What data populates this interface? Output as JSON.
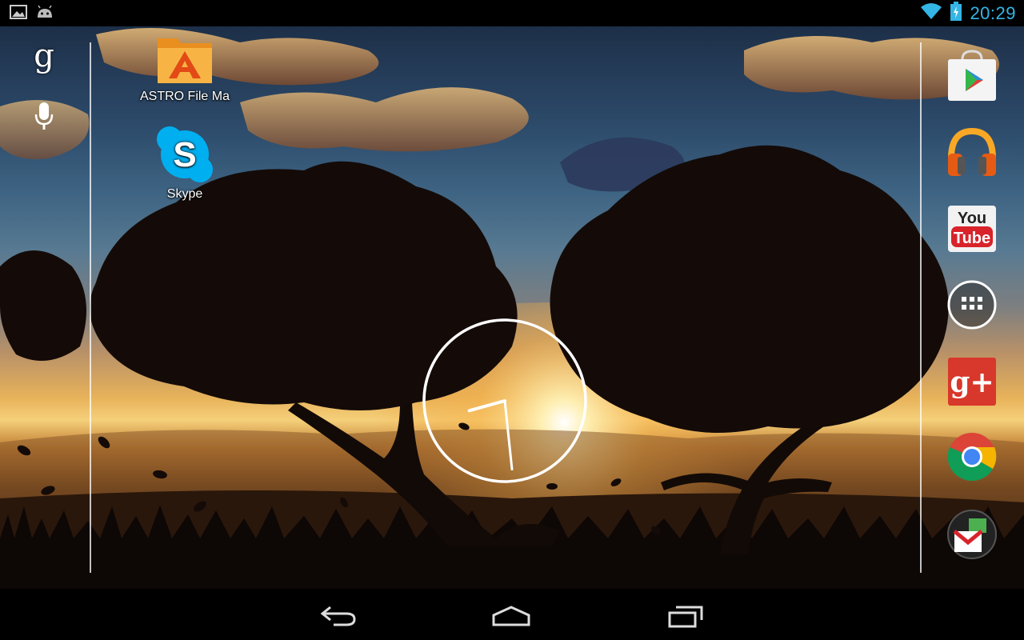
{
  "status_bar": {
    "left_icons": [
      "gallery-icon",
      "android-debug-icon"
    ],
    "right_icons": [
      "wifi-icon",
      "battery-icon"
    ],
    "time": "20:29",
    "accent_color": "#33b5e5"
  },
  "search_bar": {
    "icons": [
      "google-search-icon",
      "microphone-icon"
    ]
  },
  "shortcuts": [
    {
      "label": "ASTRO File Ma",
      "icon": "folder-astro-icon"
    },
    {
      "label": "Skype",
      "icon": "skype-icon"
    }
  ],
  "dock": [
    {
      "name": "Play Store",
      "icon": "play-store-icon"
    },
    {
      "name": "Play Music",
      "icon": "headphones-icon"
    },
    {
      "name": "YouTube",
      "icon": "youtube-icon",
      "text_top": "You",
      "text_bottom": "Tube"
    },
    {
      "name": "App Drawer",
      "icon": "apps-grid-icon"
    },
    {
      "name": "Google+",
      "icon": "google-plus-icon",
      "text": "g+"
    },
    {
      "name": "Chrome",
      "icon": "chrome-icon"
    },
    {
      "name": "Gmail",
      "icon": "gmail-folder-icon"
    }
  ],
  "nav_bar": {
    "buttons": [
      "back-icon",
      "home-icon",
      "recents-icon"
    ]
  },
  "clock_widget": {
    "hour": 20,
    "minute": 29
  }
}
